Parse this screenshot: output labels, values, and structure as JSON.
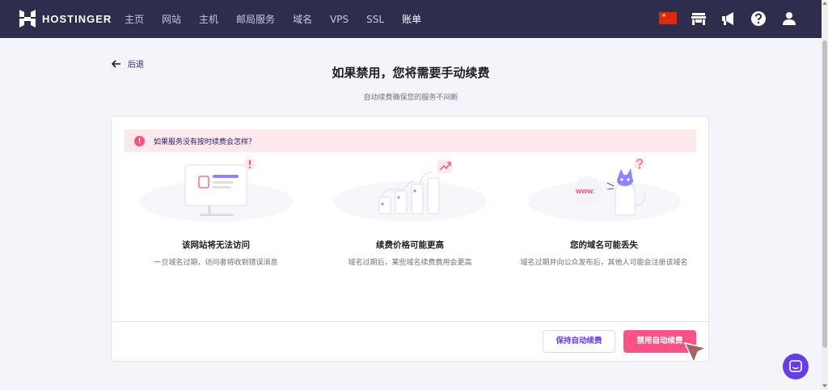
{
  "brand": {
    "name": "HOSTINGER"
  },
  "nav": {
    "items": [
      {
        "label": "主页"
      },
      {
        "label": "网站"
      },
      {
        "label": "主机"
      },
      {
        "label": "邮局服务"
      },
      {
        "label": "域名"
      },
      {
        "label": "VPS"
      },
      {
        "label": "SSL"
      },
      {
        "label": "账单"
      }
    ],
    "right_icons": [
      "china-flag-icon",
      "store-icon",
      "megaphone-icon",
      "help-icon",
      "user-icon"
    ]
  },
  "back": {
    "label": "后退"
  },
  "header": {
    "title": "如果禁用，您将需要手动续费",
    "subtitle": "自动续费确保您的服务不间断"
  },
  "alert": {
    "text": "如果服务没有按时续费会怎样？"
  },
  "columns": [
    {
      "title": "该网站将无法访问",
      "desc": "一旦域名过期，访问者将收到错误消息"
    },
    {
      "title": "续费价格可能更高",
      "desc": "域名过期后，某些域名续费费用会更高"
    },
    {
      "title": "您的域名可能丢失",
      "desc": "域名过期并向公众发布后，其他人可能会注册该域名"
    }
  ],
  "illustration": {
    "www_label": "www."
  },
  "actions": {
    "keep_label": "保持自动续费",
    "disable_label": "禁用自动续费"
  },
  "colors": {
    "nav_bg": "#2f2d4e",
    "accent": "#673de6",
    "danger": "#fc5185",
    "alert_bg": "#fde8ec"
  }
}
